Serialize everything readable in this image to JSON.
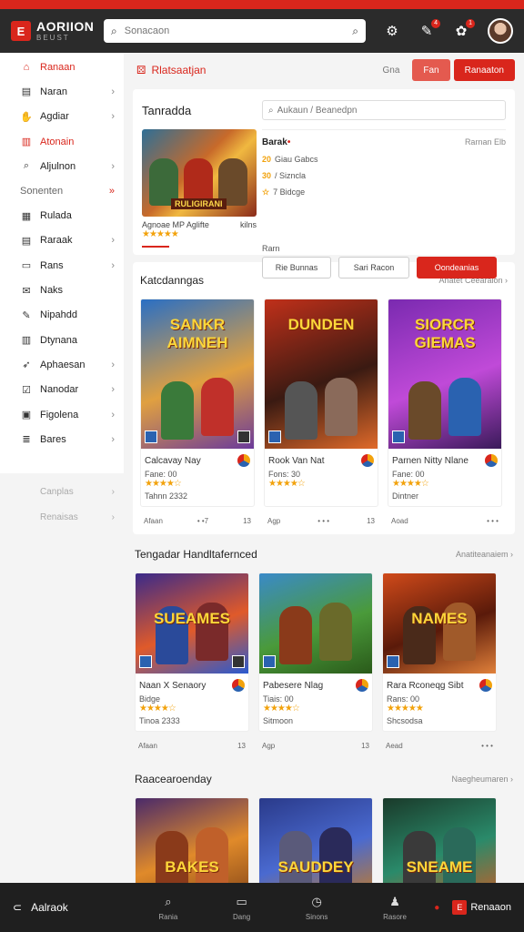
{
  "app": {
    "logo_title": "AORIION",
    "logo_sub": "BEUST",
    "search_placeholder": "Sonacaon"
  },
  "topbar": {
    "notif_badge_1": "4",
    "notif_badge_2": "1"
  },
  "sidebar": {
    "items": [
      {
        "label": "Ranaan",
        "icon": "home-icon",
        "glyph": "⌂",
        "active": true,
        "chevron": ""
      },
      {
        "label": "Naran",
        "icon": "doc-icon",
        "glyph": "▤",
        "active": false,
        "chevron": "›"
      },
      {
        "label": "Agdiar",
        "icon": "hand-icon",
        "glyph": "✋",
        "active": false,
        "chevron": "›"
      },
      {
        "label": "Atonain",
        "icon": "book-icon",
        "glyph": "▥",
        "active": true,
        "chevron": ""
      },
      {
        "label": "Aljulnon",
        "icon": "search-icon",
        "glyph": "⌕",
        "active": false,
        "chevron": "›"
      }
    ],
    "section_label": "Sonenten",
    "section_chev": "»",
    "items2": [
      {
        "label": "Rulada",
        "icon": "grid-icon",
        "glyph": "▦",
        "chevron": ""
      },
      {
        "label": "Raraak",
        "icon": "calendar-icon",
        "glyph": "▤",
        "chevron": "›"
      },
      {
        "label": "Rans",
        "icon": "folder-icon",
        "glyph": "▭",
        "chevron": "›"
      },
      {
        "label": "Naks",
        "icon": "mail-icon",
        "glyph": "✉",
        "chevron": ""
      },
      {
        "label": "Nipahdd",
        "icon": "pen-icon",
        "glyph": "✎",
        "chevron": ""
      },
      {
        "label": "Dtynana",
        "icon": "chart-icon",
        "glyph": "▥",
        "chevron": ""
      },
      {
        "label": "Aphaesan",
        "icon": "rocket-icon",
        "glyph": "➶",
        "chevron": "›"
      },
      {
        "label": "Nanodar",
        "icon": "check-icon",
        "glyph": "☑",
        "chevron": "›"
      },
      {
        "label": "Figolena",
        "icon": "clipboard-icon",
        "glyph": "▣",
        "chevron": "›"
      },
      {
        "label": "Bares",
        "icon": "list-icon",
        "glyph": "≣",
        "chevron": "›"
      }
    ],
    "muted": [
      {
        "label": "Canplas",
        "chevron": "›"
      },
      {
        "label": "Renaisas",
        "chevron": "›"
      }
    ]
  },
  "main": {
    "title": "Rlatsaatjan",
    "link": "Gna",
    "btn_small": "Fan",
    "btn_primary": "Ranaaton"
  },
  "feature": {
    "title": "Tanradda",
    "search_placeholder": "Aukaun / Beanedpn",
    "banner": "RULIGIRANI",
    "meta_left": "Agnoae MP Aglifte",
    "meta_right": "kilns",
    "stars": "★★★★★",
    "name": "Barak",
    "name_mark": "•",
    "name_right": "Rarnan",
    "name_right2": "Elb",
    "line1_num": "20",
    "line1": "Giau Gabcs",
    "line2_num": "30",
    "line2": "/ Sizncla",
    "line3_num": "☆",
    "line3": "7 Bidcge",
    "small": "Rarn",
    "btn1": "Rie Bunnas",
    "btn2": "Sari Racon",
    "btn3": "Oondeanias"
  },
  "sections": [
    {
      "title": "Katcdanngas",
      "link": "Anatet Ceearaion ›",
      "cards": [
        {
          "art": "SANKR AIMNEH",
          "name": "Calcavay Nay",
          "line": "Fane: 00",
          "stars": "★★★★☆",
          "extra": "Tahnn 2332",
          "foot_l": "Afaan",
          "foot_m": "• •7",
          "foot_r": "13"
        },
        {
          "art": "DUNDEN",
          "name": "Rook Van Nat",
          "line": "Fons: 30",
          "stars": "★★★★☆",
          "extra": "",
          "foot_l": "Agp",
          "foot_m": "• • •",
          "foot_r": "13"
        },
        {
          "art": "SIORCR GIEMAS",
          "name": "Parnen Nitty Nlane",
          "line": "Fane: 00",
          "stars": "★★★★☆",
          "extra": "Dintner",
          "foot_l": "Aoad",
          "foot_m": "",
          "foot_r": "• • •"
        }
      ]
    },
    {
      "title": "Tengadar Handltafernced",
      "link": "Anatiteanaiem ›",
      "cards": [
        {
          "art": "SUEAMES",
          "name": "Naan X Senaory",
          "line": "Bidge",
          "stars": "★★★★☆",
          "extra": "Tinoa 2333",
          "foot_l": "Afaan",
          "foot_m": "",
          "foot_r": "13"
        },
        {
          "art": "",
          "name": "Pabesere Nlag",
          "line": "Tiais: 00",
          "stars": "★★★★☆",
          "extra": "Sitmoon",
          "foot_l": "Agp",
          "foot_m": "",
          "foot_r": "13"
        },
        {
          "art": "NAMES",
          "name": "Rara Rconeqg Sibt",
          "line": "Rans: 00",
          "stars": "★★★★★",
          "extra": "Shcsodsa",
          "foot_l": "Aead",
          "foot_m": "",
          "foot_r": "• • •"
        }
      ]
    },
    {
      "title": "Raacearoenday",
      "link": "Naegheumaren ›",
      "cards": [
        {
          "art": "BAKES"
        },
        {
          "art": "SAUDDEY"
        },
        {
          "art": "SNEAME"
        }
      ]
    }
  ],
  "bottombar": {
    "back": "Aalraok",
    "tabs": [
      {
        "label": "Rania",
        "icon": "search-icon",
        "glyph": "⌕"
      },
      {
        "label": "Dang",
        "icon": "window-icon",
        "glyph": "▭"
      },
      {
        "label": "Sinons",
        "icon": "timer-icon",
        "glyph": "◷"
      },
      {
        "label": "Rasore",
        "icon": "person-icon",
        "glyph": "♟"
      }
    ],
    "right_label": "Renaaon"
  }
}
